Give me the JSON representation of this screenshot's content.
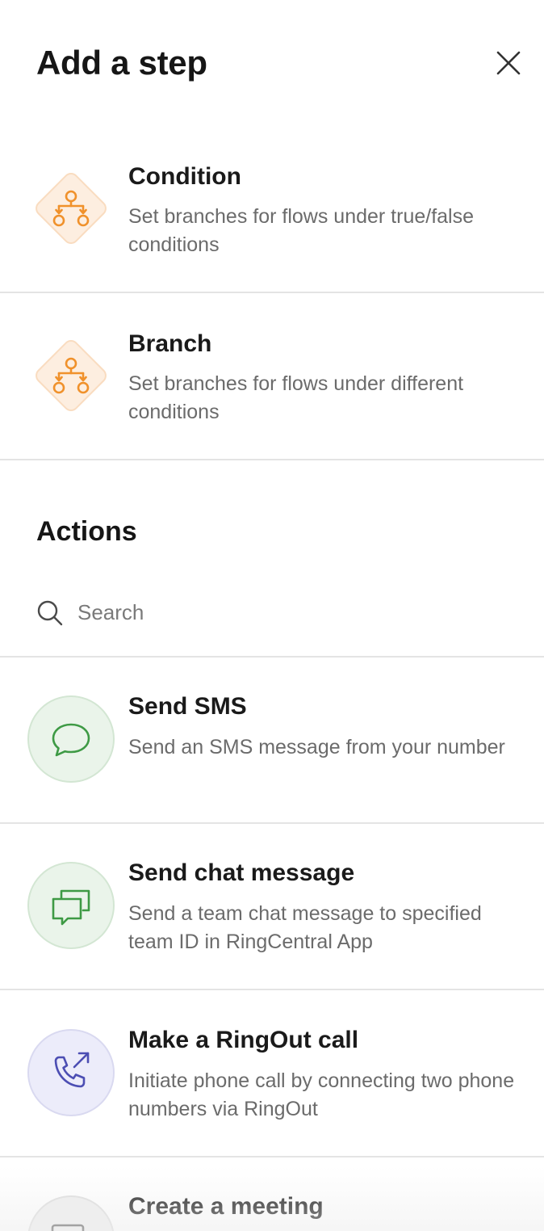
{
  "header": {
    "title": "Add a step",
    "close_icon": "close-icon"
  },
  "logic_items": [
    {
      "title": "Condition",
      "description": "Set branches for flows under true/false conditions",
      "icon": "flow-branch-icon",
      "icon_color": "#f0912b",
      "icon_bg": "#fdeee0"
    },
    {
      "title": "Branch",
      "description": "Set branches for flows under different conditions",
      "icon": "flow-branch-icon",
      "icon_color": "#f0912b",
      "icon_bg": "#fdeee0"
    }
  ],
  "actions": {
    "section_title": "Actions",
    "search": {
      "placeholder": "Search",
      "value": ""
    },
    "items": [
      {
        "title": "Send SMS",
        "description": "Send an SMS message from your number",
        "icon": "chat-bubble-icon",
        "icon_color": "#3e9a45",
        "icon_bg": "#eaf4ea"
      },
      {
        "title": "Send chat message",
        "description": "Send a team chat message to specified team ID in RingCentral App",
        "icon": "team-chat-icon",
        "icon_color": "#3e9a45",
        "icon_bg": "#eaf4ea"
      },
      {
        "title": "Make a RingOut call",
        "description": "Initiate phone call by connecting two phone numbers via RingOut",
        "icon": "phone-outgoing-icon",
        "icon_color": "#4c4eb3",
        "icon_bg": "#ececfa"
      },
      {
        "title": "Create a meeting",
        "description": "",
        "icon": "calendar-icon",
        "icon_color": "#555555",
        "icon_bg": "#eeeeee"
      }
    ]
  }
}
